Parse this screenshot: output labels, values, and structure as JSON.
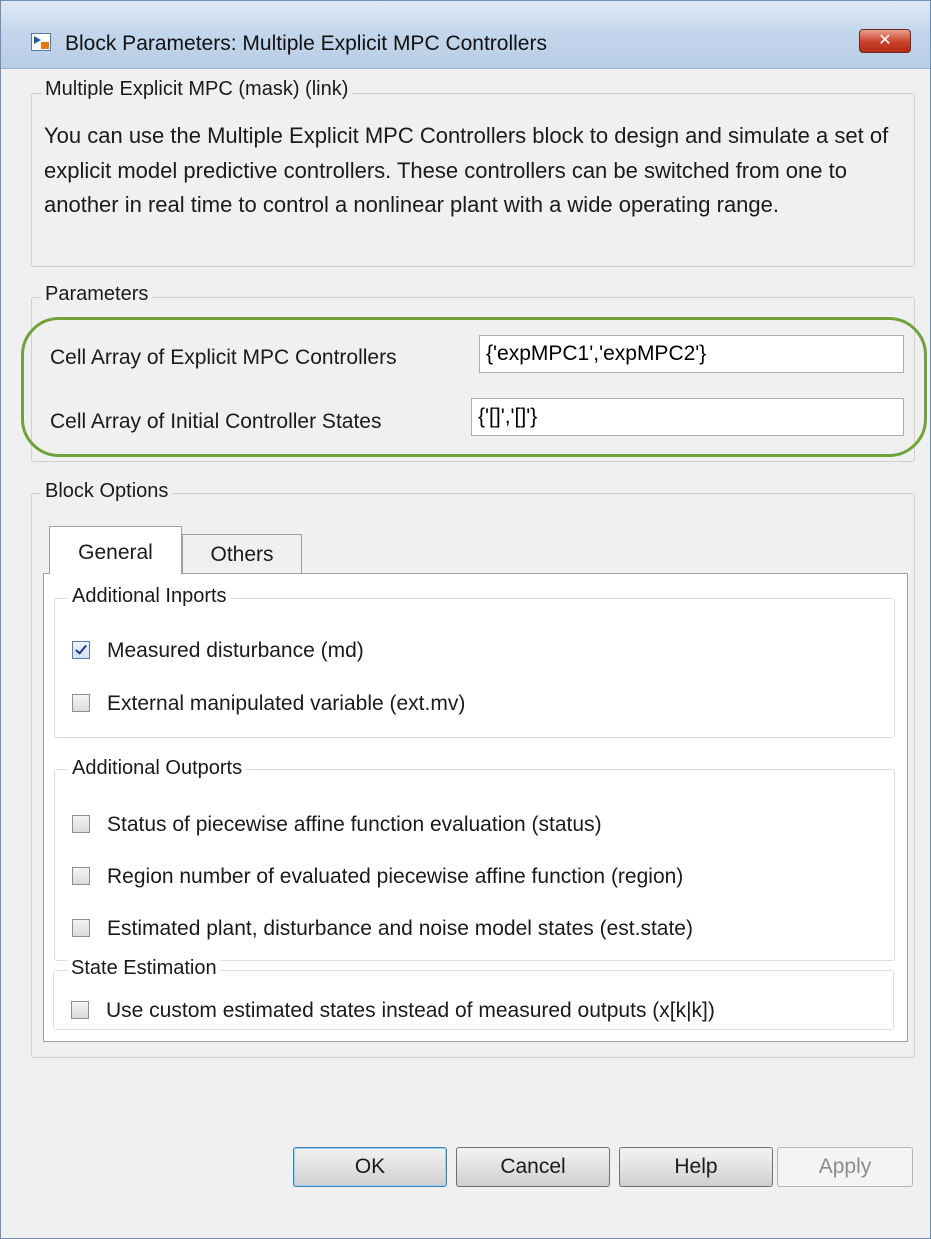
{
  "window": {
    "title": "Block Parameters: Multiple Explicit MPC Controllers",
    "close_glyph": "✕"
  },
  "mask": {
    "legend": "Multiple Explicit MPC (mask) (link)",
    "description": "You can use the Multiple Explicit MPC Controllers block to design and simulate a set of explicit model predictive controllers. These controllers can be switched from one to another in real time to control a nonlinear plant with a wide operating range."
  },
  "parameters": {
    "legend": "Parameters",
    "controllers_label": "Cell Array of Explicit MPC Controllers",
    "controllers_value": "{'expMPC1','expMPC2'}",
    "states_label": "Cell Array of Initial Controller States",
    "states_value": "{'[]','[]'}",
    "highlight_color": "#6fa33a"
  },
  "block_options": {
    "legend": "Block Options",
    "tabs": [
      {
        "label": "General",
        "active": true
      },
      {
        "label": "Others",
        "active": false
      }
    ],
    "inports": {
      "legend": "Additional Inports",
      "items": [
        {
          "label": "Measured disturbance (md)",
          "checked": true
        },
        {
          "label": "External manipulated variable (ext.mv)",
          "checked": false
        }
      ]
    },
    "outports": {
      "legend": "Additional Outports",
      "items": [
        {
          "label": "Status of piecewise affine function evaluation (status)",
          "checked": false
        },
        {
          "label": "Region number of evaluated piecewise affine function (region)",
          "checked": false
        },
        {
          "label": "Estimated plant, disturbance and noise model states (est.state)",
          "checked": false
        }
      ]
    },
    "estimation": {
      "legend": "State Estimation",
      "items": [
        {
          "label": "Use custom estimated states instead of measured outputs (x[k|k])",
          "checked": false
        }
      ]
    }
  },
  "buttons": {
    "ok": "OK",
    "cancel": "Cancel",
    "help": "Help",
    "apply": "Apply"
  }
}
